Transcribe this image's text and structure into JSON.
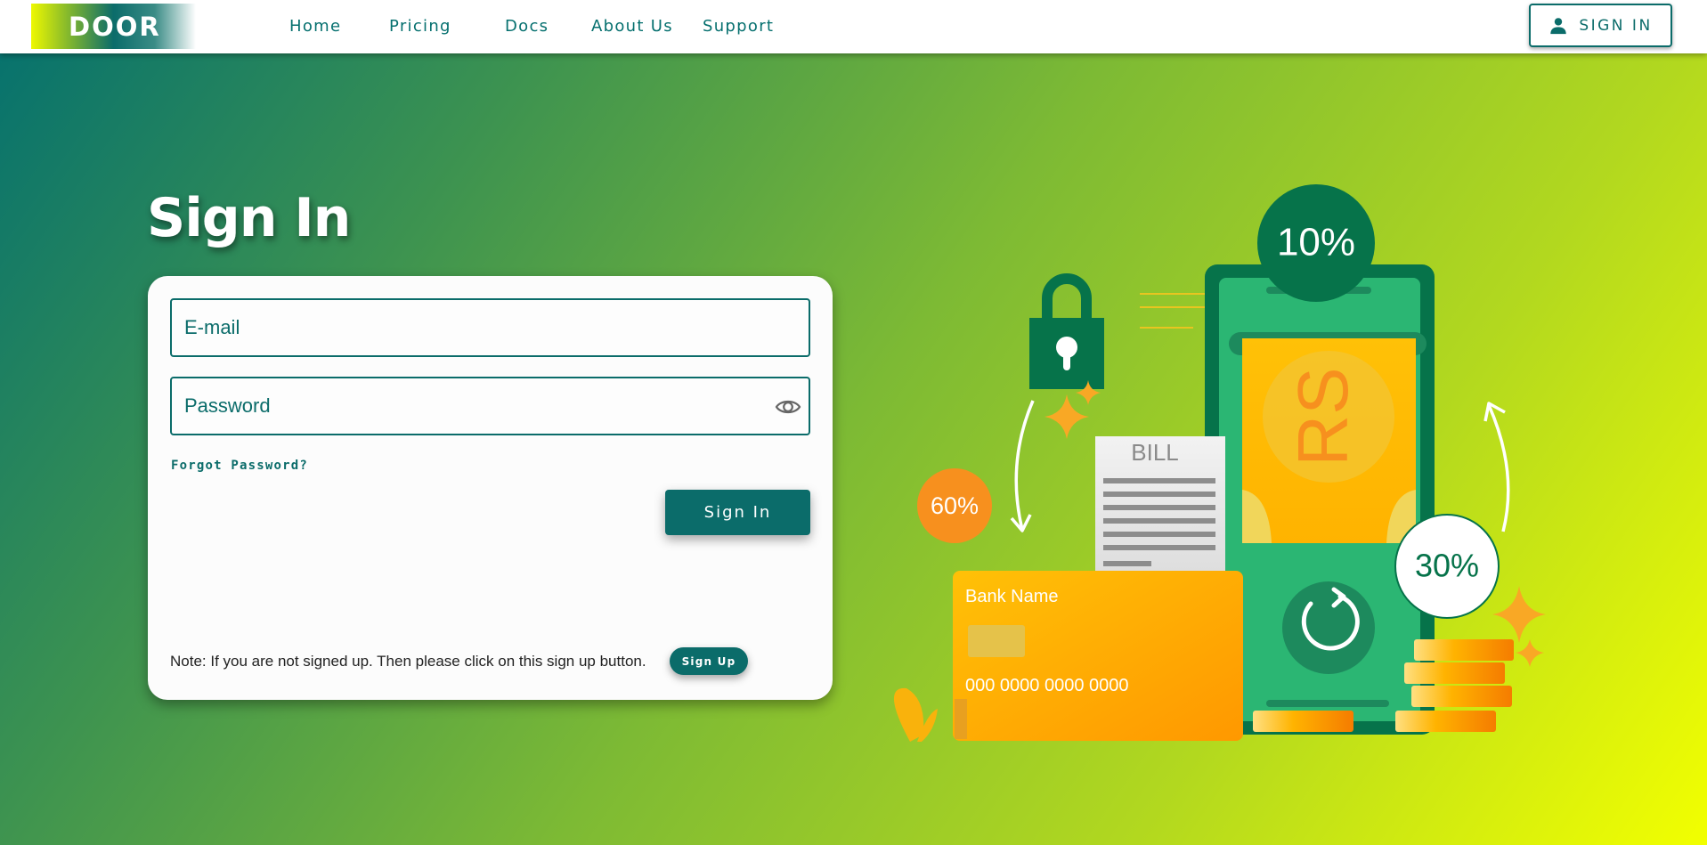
{
  "nav": {
    "logo": "DOOR",
    "links": [
      "Home",
      "Pricing",
      "Docs",
      "About Us",
      "Support"
    ],
    "signin_label": "SIGN IN"
  },
  "page": {
    "title": "Sign In"
  },
  "form": {
    "email_placeholder": "E-mail",
    "password_placeholder": "Password",
    "forgot_label": "Forgot Password?",
    "submit_label": "Sign In",
    "note": "Note: If you are not signed up. Then please click on this sign up button.",
    "signup_label": "Sign Up"
  },
  "illustration": {
    "badge_top": "10%",
    "badge_left": "60%",
    "badge_right": "30%",
    "bill_label": "BILL",
    "card_bank": "Bank Name",
    "card_number": "000 0000 0000 0000",
    "note_symbol": "RS"
  },
  "colors": {
    "brand": "#0b6c6a",
    "accent_orange": "#f7a01a",
    "phone_green": "#2bb673",
    "dark_green": "#06734a"
  },
  "icons": {
    "user": "person-icon",
    "eye": "eye-icon",
    "lock": "padlock-icon"
  }
}
